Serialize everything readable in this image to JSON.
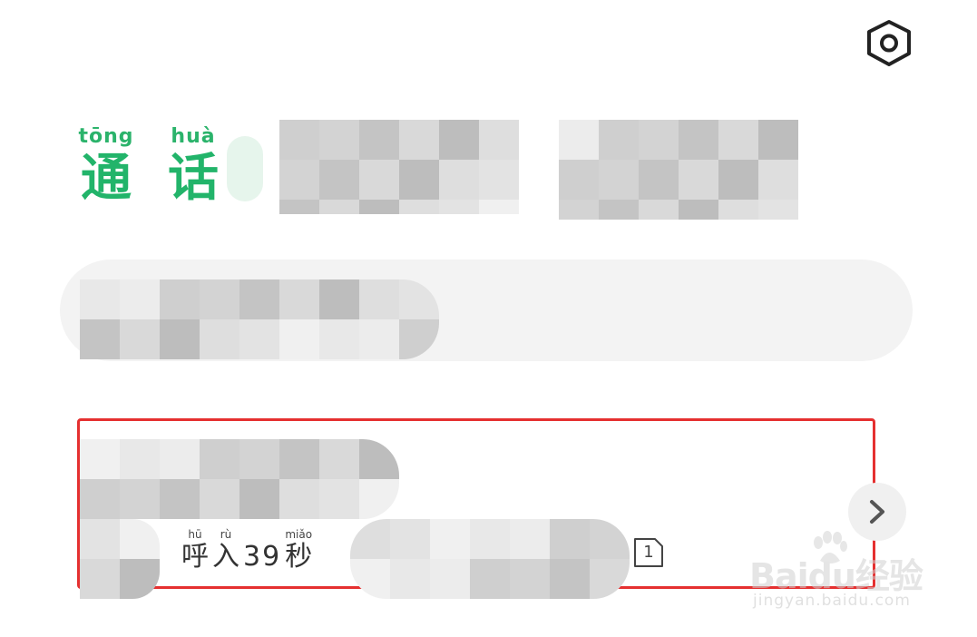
{
  "header": {
    "title_chars": [
      {
        "pinyin": "tōng",
        "hanzi": "通"
      },
      {
        "pinyin": "huà",
        "hanzi": "话"
      }
    ],
    "settings_icon": "hexagon-gear-icon"
  },
  "call_record": {
    "status_chars": [
      {
        "pinyin": "hū",
        "hanzi": "呼"
      },
      {
        "pinyin": "rù",
        "hanzi": "入"
      }
    ],
    "duration_number": "39",
    "duration_unit": {
      "pinyin": "miǎo",
      "hanzi": "秒"
    },
    "sim_slot": "1",
    "chevron_icon": "chevron-right-icon"
  },
  "watermark": {
    "logo_text": "Baidu经验",
    "url_text": "jingyan.baidu.com"
  },
  "colors": {
    "accent_green": "#22b46a",
    "highlight_red": "#e53030",
    "mosaic_gray": "#d8d8d8"
  }
}
